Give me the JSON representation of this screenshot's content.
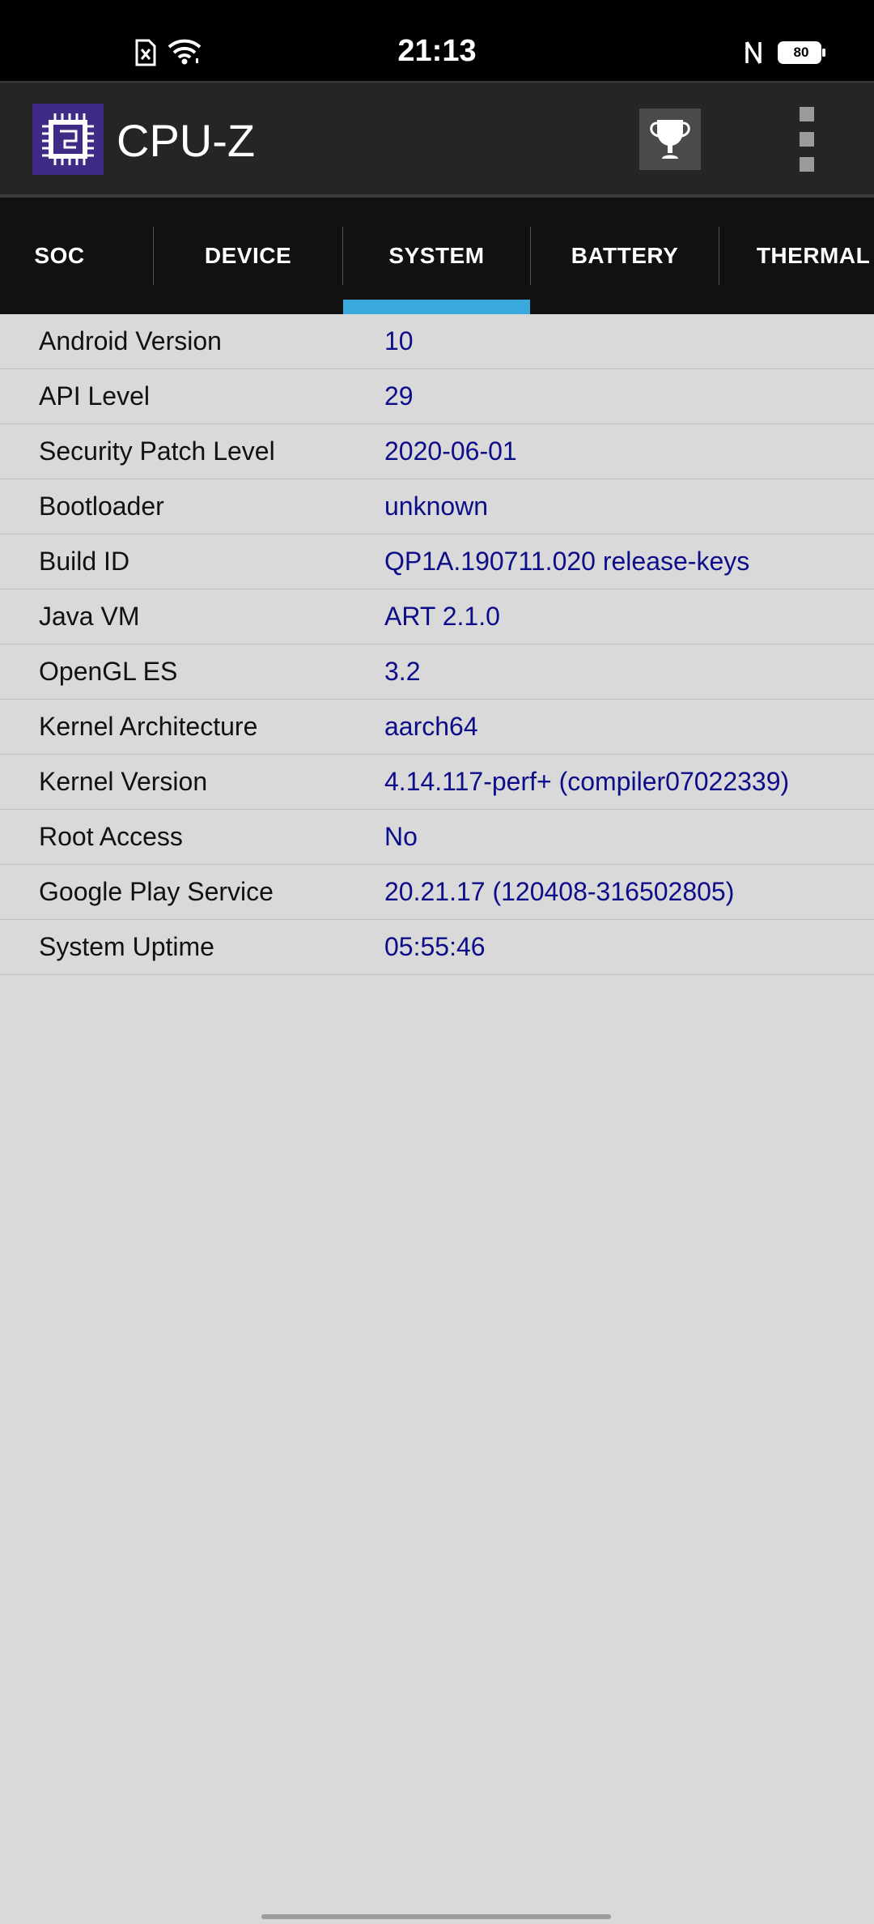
{
  "status_bar": {
    "time": "21:13",
    "battery_level": "80",
    "icons": [
      "no-sim-icon",
      "wifi-icon",
      "nfc-icon",
      "battery-icon"
    ]
  },
  "app_bar": {
    "title": "CPU-Z",
    "logo_icon": "cpu-chip-icon",
    "trophy_icon": "trophy-icon",
    "menu_icon": "overflow-menu-icon",
    "logo_color": "#3f2a86"
  },
  "tabs": [
    {
      "label": "SOC",
      "active": false
    },
    {
      "label": "DEVICE",
      "active": false
    },
    {
      "label": "SYSTEM",
      "active": true
    },
    {
      "label": "BATTERY",
      "active": false
    },
    {
      "label": "THERMAL",
      "active": false
    }
  ],
  "accent_color": "#3aa9de",
  "system_info": [
    {
      "label": "Android Version",
      "value": "10"
    },
    {
      "label": "API Level",
      "value": "29"
    },
    {
      "label": "Security Patch Level",
      "value": "2020-06-01"
    },
    {
      "label": "Bootloader",
      "value": "unknown"
    },
    {
      "label": "Build ID",
      "value": "QP1A.190711.020 release-keys"
    },
    {
      "label": "Java VM",
      "value": "ART 2.1.0"
    },
    {
      "label": "OpenGL ES",
      "value": "3.2"
    },
    {
      "label": "Kernel Architecture",
      "value": "aarch64"
    },
    {
      "label": "Kernel Version",
      "value": "4.14.117-perf+ (compiler07022339)"
    },
    {
      "label": "Root Access",
      "value": "No"
    },
    {
      "label": "Google Play Service",
      "value": "20.21.17 (120408-316502805)"
    },
    {
      "label": "System Uptime",
      "value": "05:55:46"
    }
  ]
}
